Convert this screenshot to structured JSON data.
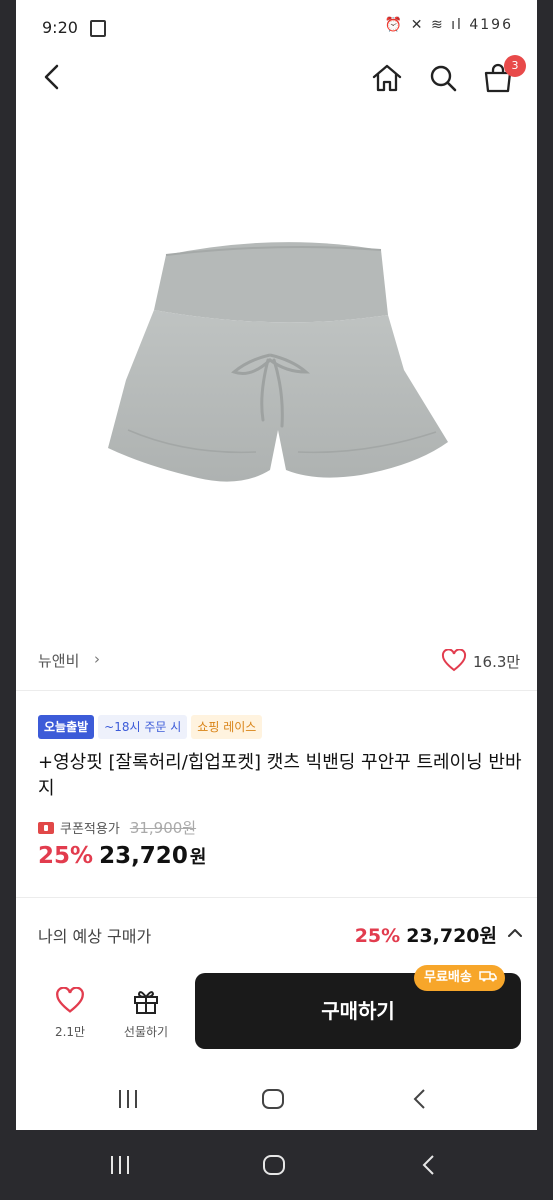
{
  "status_bar": {
    "time": "9:20",
    "right": "4196"
  },
  "header": {
    "cart_count": "3"
  },
  "brand": {
    "name": "뉴앤비",
    "chevron": "›",
    "likes": "16.3만"
  },
  "tags": {
    "today": "오늘출발",
    "time": "~18시 주문 시",
    "shop": "쇼핑 레이스"
  },
  "product": {
    "title": "+영상핏 [잘록허리/힙업포켓] 캣츠 빅밴딩 꾸안꾸 트레이닝 반바지",
    "coupon_label": "쿠폰적용가",
    "original_price": "31,900원",
    "discount": "25%",
    "price": "23,720",
    "won": "원"
  },
  "expected": {
    "label": "나의 예상 구매가",
    "discount": "25%",
    "price": "23,720원"
  },
  "bottom": {
    "wish_count": "2.1만",
    "gift_label": "선물하기",
    "buy_label": "구매하기",
    "free_shipping": "무료배송"
  },
  "colors": {
    "discount_red": "#e23c4e",
    "buy_button": "#1a1a1a",
    "shipping_badge": "#f7a62a",
    "tag_blue": "#3c5bd8"
  }
}
